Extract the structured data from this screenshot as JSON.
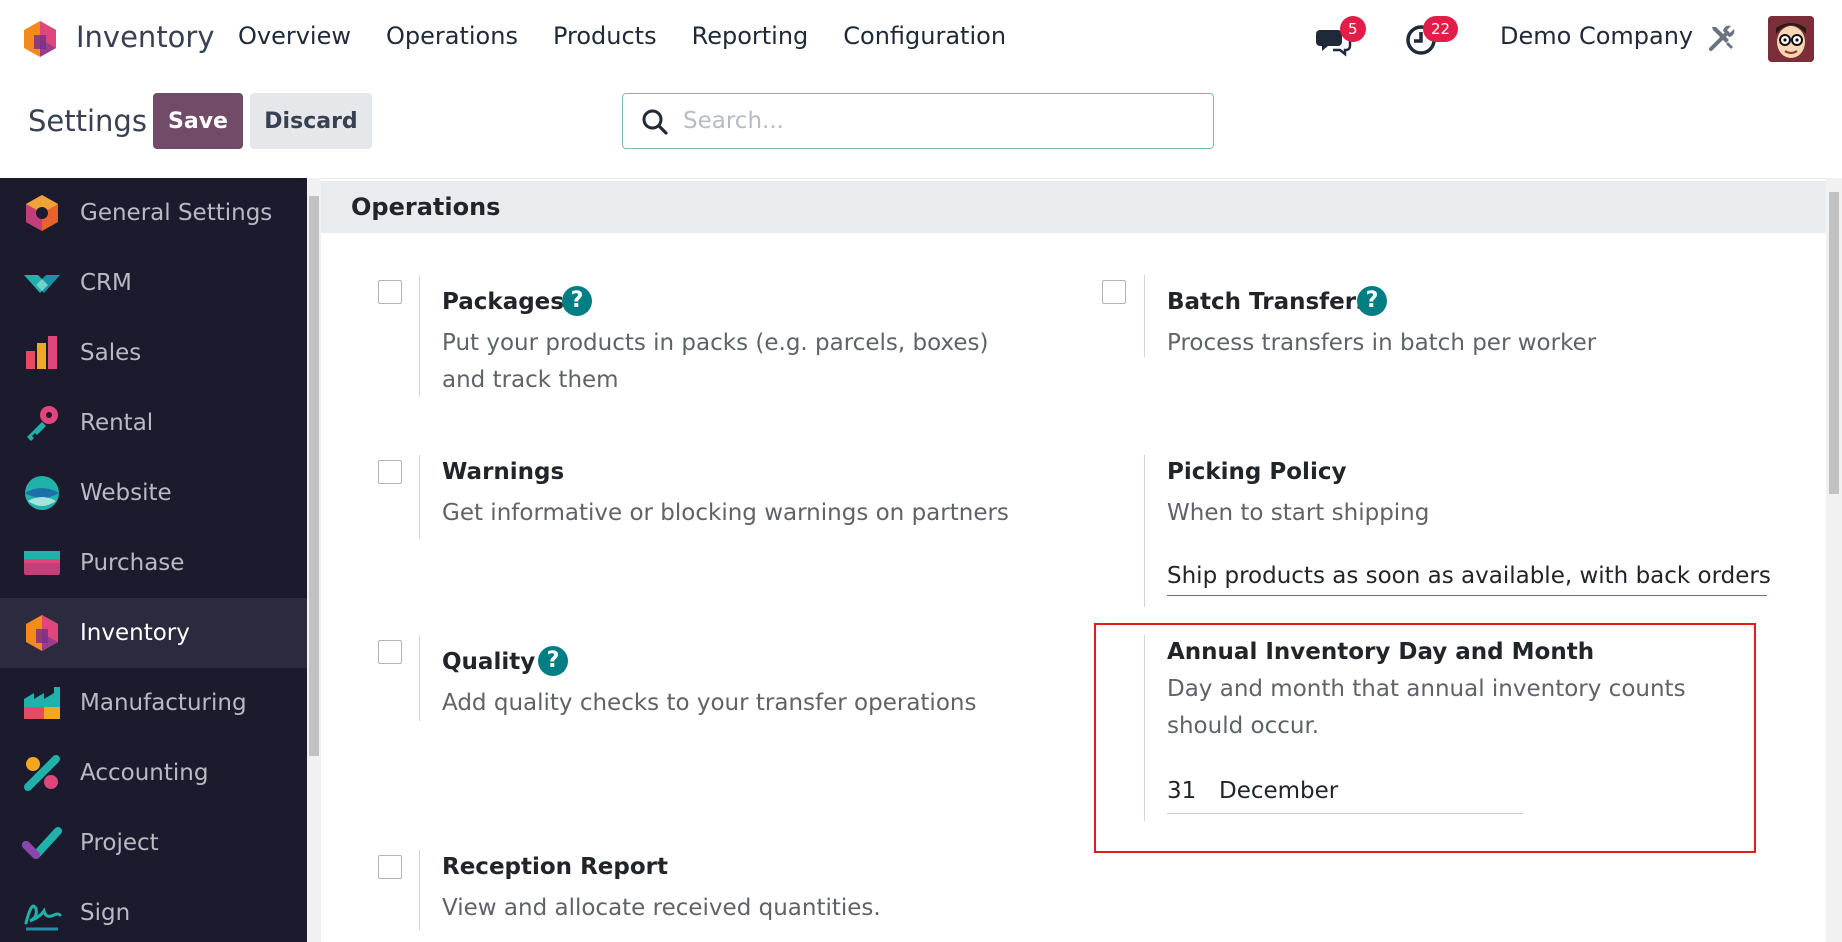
{
  "navbar": {
    "app_name": "Inventory",
    "menu": [
      "Overview",
      "Operations",
      "Products",
      "Reporting",
      "Configuration"
    ],
    "chat_badge": "5",
    "activity_badge": "22",
    "company": "Demo Company"
  },
  "control": {
    "title": "Settings",
    "save_label": "Save",
    "discard_label": "Discard",
    "search_placeholder": "Search..."
  },
  "sidebar": {
    "items": [
      {
        "label": "General Settings",
        "icon": "general-settings-icon"
      },
      {
        "label": "CRM",
        "icon": "crm-icon"
      },
      {
        "label": "Sales",
        "icon": "sales-icon"
      },
      {
        "label": "Rental",
        "icon": "rental-icon"
      },
      {
        "label": "Website",
        "icon": "website-icon"
      },
      {
        "label": "Purchase",
        "icon": "purchase-icon"
      },
      {
        "label": "Inventory",
        "icon": "inventory-icon",
        "active": true
      },
      {
        "label": "Manufacturing",
        "icon": "manufacturing-icon"
      },
      {
        "label": "Accounting",
        "icon": "accounting-icon"
      },
      {
        "label": "Project",
        "icon": "project-icon"
      },
      {
        "label": "Sign",
        "icon": "sign-icon"
      }
    ]
  },
  "section": {
    "title": "Operations",
    "packages": {
      "title": "Packages",
      "desc": "Put your products in packs (e.g. parcels, boxes) and track them"
    },
    "batch": {
      "title": "Batch Transfers",
      "desc": "Process transfers in batch per worker"
    },
    "warnings": {
      "title": "Warnings",
      "desc": "Get informative or blocking warnings on partners"
    },
    "picking": {
      "title": "Picking Policy",
      "desc": "When to start shipping",
      "value": "Ship products as soon as available, with back orders"
    },
    "quality": {
      "title": "Quality",
      "desc": "Add quality checks to your transfer operations"
    },
    "annual": {
      "title": "Annual Inventory Day and Month",
      "desc": "Day and month that annual inventory counts should occur.",
      "day": "31",
      "month": "December"
    },
    "reception": {
      "title": "Reception Report",
      "desc": "View and allocate received quantities."
    }
  },
  "colors": {
    "brand": "#714b67",
    "teal": "#017e84",
    "sidebar_bg": "#1c1b2e",
    "badge": "#e11d48",
    "highlight": "#e11d1d"
  }
}
